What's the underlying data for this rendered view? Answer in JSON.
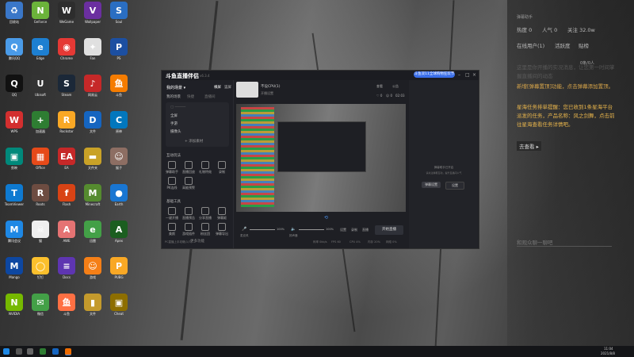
{
  "desktop_icons": [
    {
      "label": "回收站",
      "color": "#3a77c8",
      "glyph": "♻"
    },
    {
      "label": "GeForce",
      "color": "#6bb33a",
      "glyph": "N"
    },
    {
      "label": "WeGame",
      "color": "#2d2d2d",
      "glyph": "W"
    },
    {
      "label": "Wallpaper",
      "color": "#6b2fa0",
      "glyph": "V"
    },
    {
      "label": "Soul",
      "color": "#2a6ec2",
      "glyph": "S"
    },
    {
      "label": "腾讯QQ",
      "color": "#4a9be8",
      "glyph": "Q"
    },
    {
      "label": "Edge",
      "color": "#1d7fd1",
      "glyph": "e"
    },
    {
      "label": "Chrome",
      "color": "#e53935",
      "glyph": "◉"
    },
    {
      "label": "Fan",
      "color": "#e0e0e0",
      "glyph": "✦"
    },
    {
      "label": "PS",
      "color": "#1c4fa1",
      "glyph": "P"
    },
    {
      "label": "QQ",
      "color": "#111",
      "glyph": "Q"
    },
    {
      "label": "Ubisoft",
      "color": "#333",
      "glyph": "U"
    },
    {
      "label": "Steam",
      "color": "#1b2838",
      "glyph": "S"
    },
    {
      "label": "网易云",
      "color": "#c62828",
      "glyph": "♪"
    },
    {
      "label": "斗鱼",
      "color": "#f57c00",
      "glyph": "鱼"
    },
    {
      "label": "WPS",
      "color": "#d32f2f",
      "glyph": "W"
    },
    {
      "label": "加速器",
      "color": "#2e7d32",
      "glyph": "+"
    },
    {
      "label": "Rockstar",
      "color": "#f9a825",
      "glyph": "R"
    },
    {
      "label": "文件",
      "color": "#1565c0",
      "glyph": "D"
    },
    {
      "label": "原神",
      "color": "#0277bd",
      "glyph": "C"
    },
    {
      "label": "剪映",
      "color": "#00897b",
      "glyph": "▣"
    },
    {
      "label": "Office",
      "color": "#e64a19",
      "glyph": "▦"
    },
    {
      "label": "EA",
      "color": "#c62828",
      "glyph": "EA"
    },
    {
      "label": "文件夹",
      "color": "#c9a227",
      "glyph": "▬"
    },
    {
      "label": "猴子",
      "color": "#8d6e63",
      "glyph": "☺"
    },
    {
      "label": "TeamViewer",
      "color": "#0e7ad1",
      "glyph": "T"
    },
    {
      "label": "Roots",
      "color": "#6d4c41",
      "glyph": "R"
    },
    {
      "label": "Flash",
      "color": "#d84315",
      "glyph": "f"
    },
    {
      "label": "Minecraft",
      "color": "#558b2f",
      "glyph": "M"
    },
    {
      "label": "Earth",
      "color": "#1976d2",
      "glyph": "●"
    },
    {
      "label": "腾讯会议",
      "color": "#1e88e5",
      "glyph": "M"
    },
    {
      "label": "猫",
      "color": "#eee",
      "glyph": "☠"
    },
    {
      "label": "AWE",
      "color": "#e57373",
      "glyph": "A"
    },
    {
      "label": "迅雷",
      "color": "#43a047",
      "glyph": "e"
    },
    {
      "label": "Apex",
      "color": "#1b5e20",
      "glyph": "A"
    },
    {
      "label": "Mango",
      "color": "#0d47a1",
      "glyph": "M"
    },
    {
      "label": "钉钉",
      "color": "#fbc02d",
      "glyph": "◯"
    },
    {
      "label": "Docs",
      "color": "#5e35b1",
      "glyph": "≡"
    },
    {
      "label": "游戏",
      "color": "#f57f17",
      "glyph": "☺"
    },
    {
      "label": "PUBG",
      "color": "#f9a825",
      "glyph": "P"
    },
    {
      "label": "NVIDIA",
      "color": "#76b900",
      "glyph": "N"
    },
    {
      "label": "微信",
      "color": "#43a047",
      "glyph": "✉"
    },
    {
      "label": "斗鱼",
      "color": "#ff7043",
      "glyph": "鱼"
    },
    {
      "label": "文件",
      "color": "#c49a2c",
      "glyph": "▮"
    },
    {
      "label": "Cheat",
      "color": "#8d6e00",
      "glyph": "▣"
    }
  ],
  "window": {
    "logo": "斗鱼直播伴侣",
    "version": "v6.3.4",
    "promo": "斗鱼双11全球购物狂欢节",
    "left": {
      "scene_title": "我的场景 ▾",
      "scene_tabs": [
        "横屏",
        "竖屏"
      ],
      "sub_tabs": [
        "我的场景",
        "快捷",
        "直播间"
      ],
      "scene_items": [
        "全屏",
        "手游",
        "摄像头"
      ],
      "add_scene": "+ 添加素材",
      "tools_title": "互动玩法",
      "tools": [
        "弹幕助手",
        "直播回放",
        "礼物特效",
        "录制",
        "PK连线",
        "高能预警"
      ],
      "tools2_title": "基础工具",
      "tools2": [
        "一键开播",
        "直播预告",
        "分享直播",
        "弹幕姬",
        "美颜",
        "游戏插件",
        "粉丝团",
        "弹幕导出"
      ],
      "more": "更多功能"
    },
    "center": {
      "source_name": "不设CPU(1)",
      "top_links": [
        "开播设置",
        "查看",
        "公告"
      ],
      "stat_like": "0",
      "stat_view": "0",
      "stat_fans": "0",
      "stat_time": "02:03",
      "mic_label": "麦克风",
      "mic_pct": "100%",
      "spk_label": "扬声器",
      "spk_pct": "100%",
      "tools": [
        "设置",
        "录制",
        "直播"
      ],
      "start_button": "开始直播",
      "status_bar": [
        "码率 0kb/s",
        "FPS 60",
        "CPU 4%",
        "内存 20%",
        "网络 0%"
      ],
      "pc_note": "PC直播上手攻略(1/3)"
    },
    "right": {
      "hint": "弹幕助手已开启",
      "sub": "请关注弹幕互动，提升直播间人气",
      "btn_left": "弹幕设置",
      "btn_right": "设置"
    }
  },
  "chat": {
    "title": "弹幕助手",
    "heat_label": "热度 0",
    "pop_label": "人气 0",
    "follow_label": "关注 32.0w",
    "tabs": [
      "在线用户(1)",
      "活跃度",
      "贴榜"
    ],
    "online_count": "0条/0人",
    "faded": "这里是你开播的实况消息，让您第一时间掌握直播间的动态",
    "msg1": "新增[弹幕置顶]功能，点击弹幕添加置顶。",
    "msg2": "星海任务排单提醒：您已收到1条星海平台派发的任务，产品名称：风之剑舞，点击前往星海查看任务详情吧。",
    "link": "去查看 ▸",
    "input_placeholder": "和观众聊一聊吧"
  },
  "taskbar": {
    "time": "11:04",
    "date": "2021/8/8"
  },
  "colors": {
    "accent": "#3a6ee8",
    "start": "#2f3138",
    "chat_msg": "#d9a64a",
    "logo": "#ffffff"
  }
}
